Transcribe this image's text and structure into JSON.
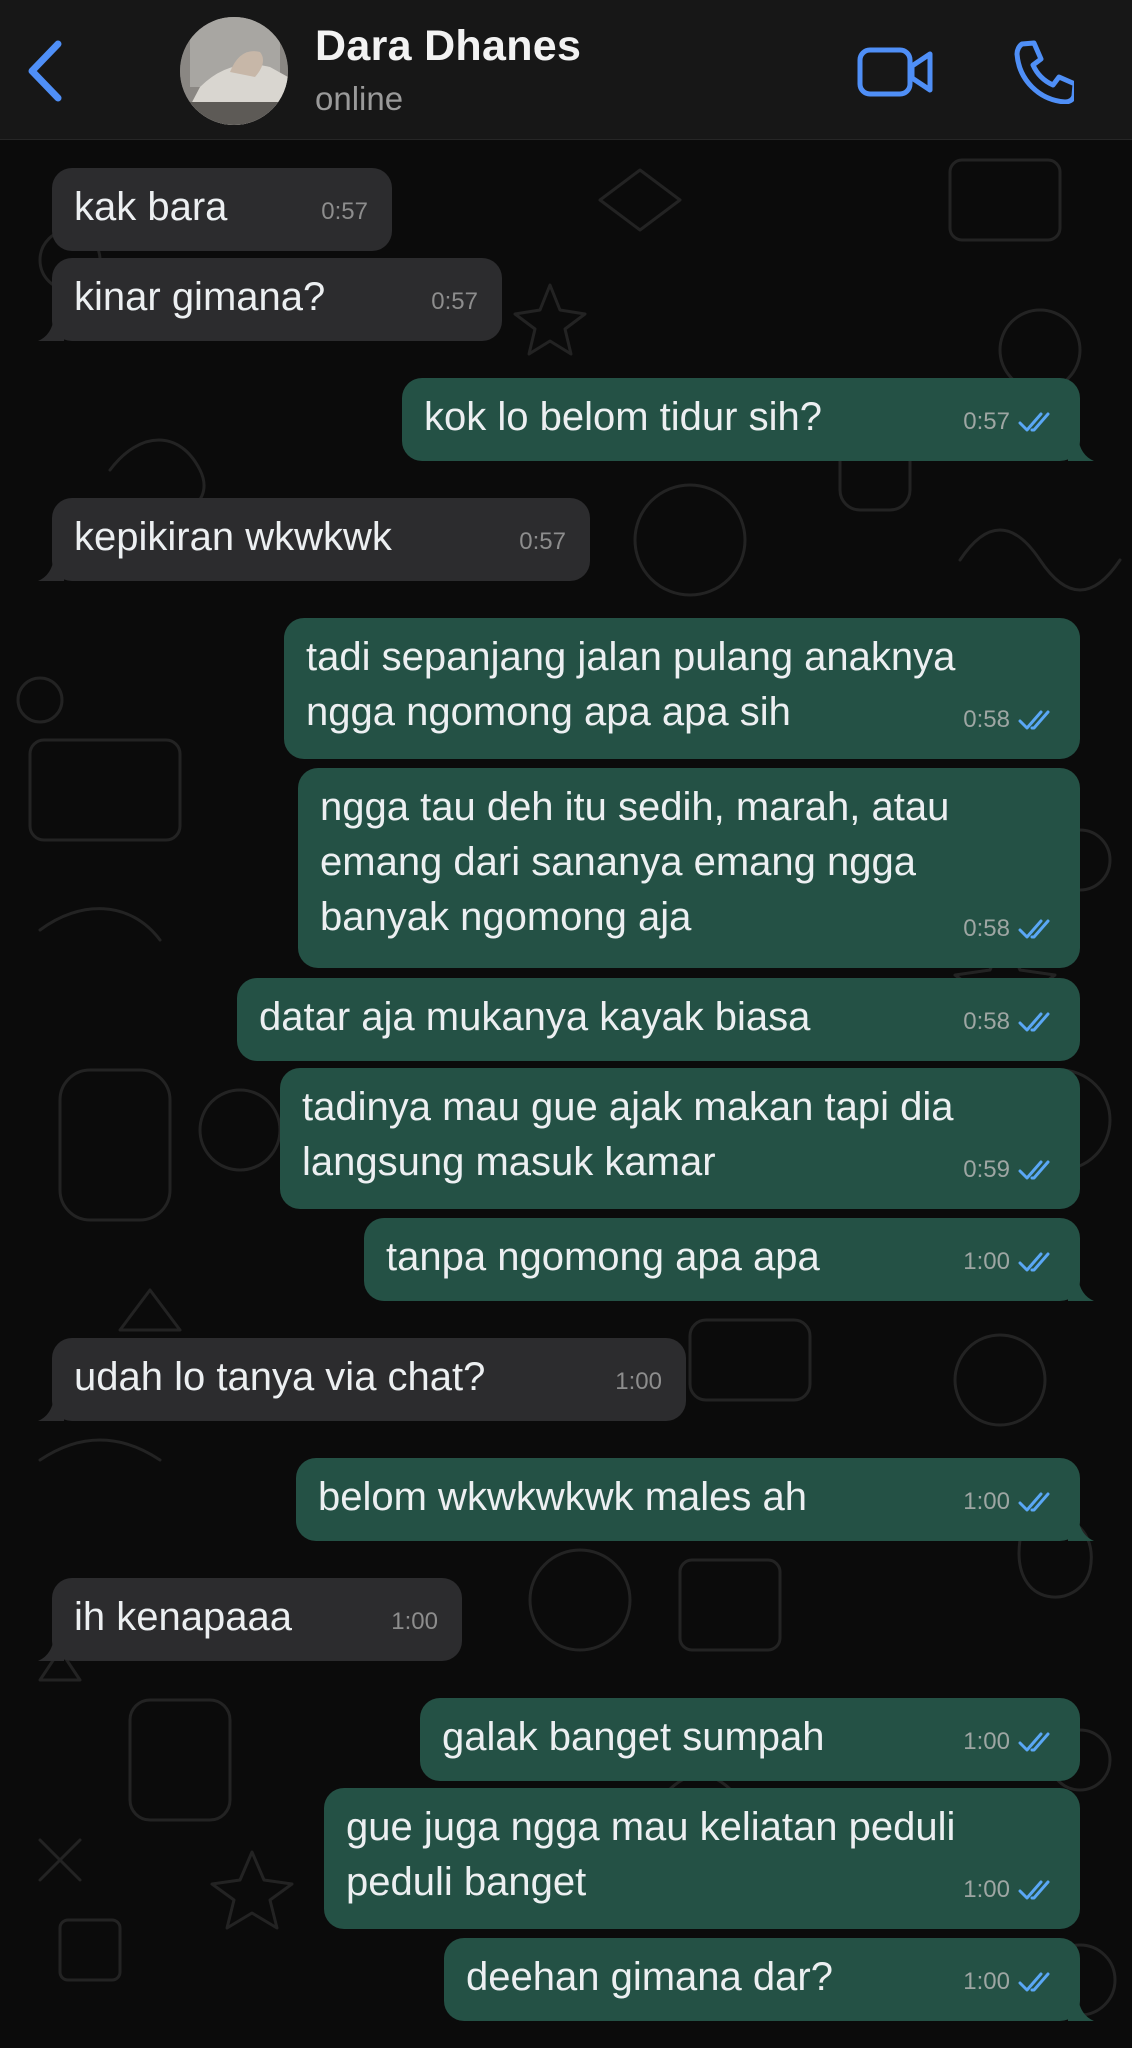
{
  "header": {
    "contact_name": "Dara Dhanes",
    "status": "online"
  },
  "messages": [
    {
      "dir": "in",
      "text": "kak bara",
      "time": "0:57"
    },
    {
      "dir": "in",
      "text": "kinar gimana?",
      "time": "0:57"
    },
    {
      "dir": "out",
      "text": "kok lo belom tidur sih?",
      "time": "0:57"
    },
    {
      "dir": "in",
      "text": "kepikiran wkwkwk",
      "time": "0:57"
    },
    {
      "dir": "out",
      "text": "tadi sepanjang jalan pulang anaknya\nngga ngomong apa apa sih",
      "time": "0:58"
    },
    {
      "dir": "out",
      "text": "ngga tau deh itu sedih, marah, atau\nemang dari sananya emang ngga\nbanyak ngomong aja",
      "time": "0:58"
    },
    {
      "dir": "out",
      "text": "datar aja mukanya kayak biasa",
      "time": "0:58"
    },
    {
      "dir": "out",
      "text": "tadinya mau gue ajak makan tapi dia\nlangsung masuk kamar",
      "time": "0:59"
    },
    {
      "dir": "out",
      "text": "tanpa ngomong apa apa",
      "time": "1:00"
    },
    {
      "dir": "in",
      "text": "udah lo tanya via chat?",
      "time": "1:00"
    },
    {
      "dir": "out",
      "text": "belom wkwkwkwk males ah",
      "time": "1:00"
    },
    {
      "dir": "in",
      "text": "ih kenapaaa",
      "time": "1:00"
    },
    {
      "dir": "out",
      "text": "galak banget sumpah",
      "time": "1:00"
    },
    {
      "dir": "out",
      "text": "gue juga ngga mau keliatan peduli\npeduli banget",
      "time": "1:00"
    },
    {
      "dir": "out",
      "text": "deehan gimana dar?",
      "time": "1:00"
    }
  ],
  "colors": {
    "accent": "#4f8ff7",
    "incoming_bubble": "#2c2c2e",
    "outgoing_bubble": "#245145",
    "read_ticks": "#5aa7f5"
  }
}
